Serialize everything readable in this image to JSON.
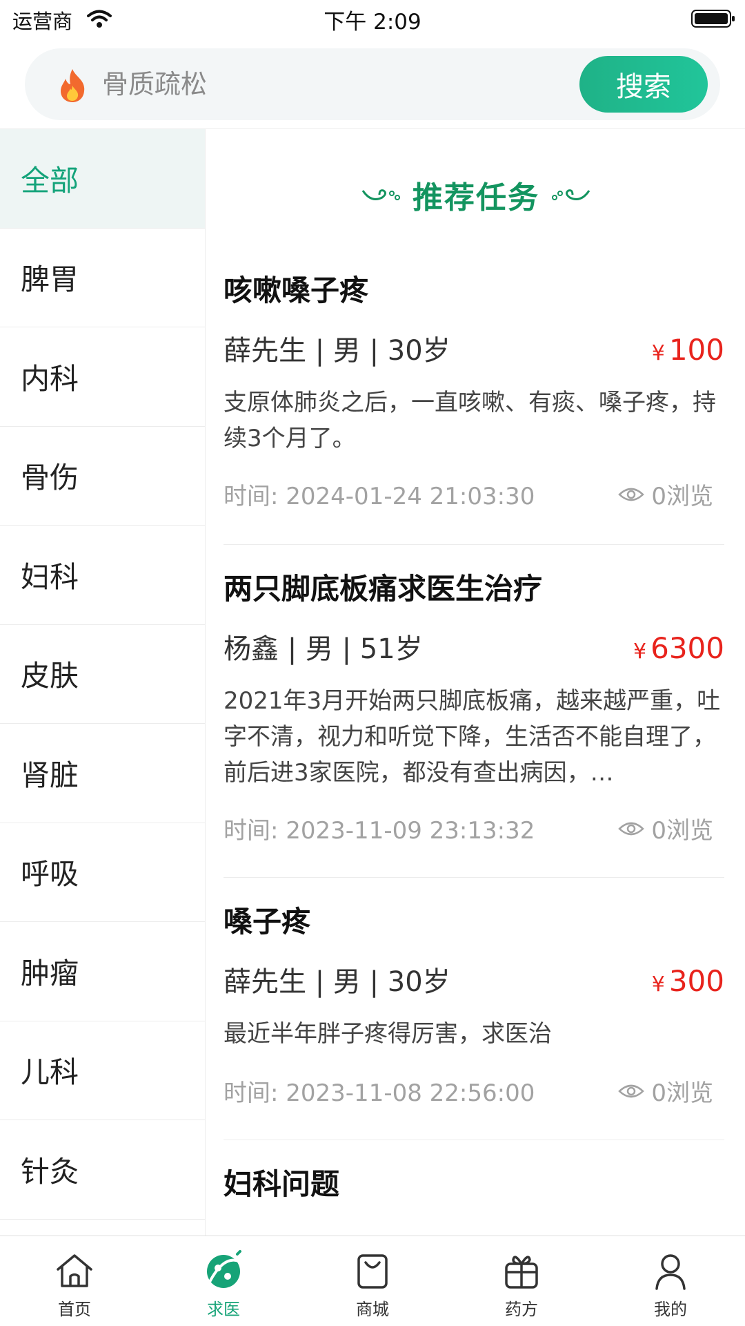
{
  "status_bar": {
    "carrier": "运营商",
    "time": "下午 2:09"
  },
  "search": {
    "placeholder": "骨质疏松",
    "button_label": "搜索"
  },
  "sidebar": {
    "items": [
      {
        "label": "全部",
        "active": true
      },
      {
        "label": "脾胃"
      },
      {
        "label": "内科"
      },
      {
        "label": "骨伤"
      },
      {
        "label": "妇科"
      },
      {
        "label": "皮肤"
      },
      {
        "label": "肾脏"
      },
      {
        "label": "呼吸"
      },
      {
        "label": "肿瘤"
      },
      {
        "label": "儿科"
      },
      {
        "label": "针灸"
      }
    ]
  },
  "main": {
    "section_title": "推荐任务",
    "tasks": [
      {
        "title": "咳嗽嗓子疼",
        "patient": "薛先生 | 男 | 30岁",
        "currency": "¥",
        "price": "100",
        "description": "支原体肺炎之后，一直咳嗽、有痰、嗓子疼，持续3个月了。",
        "time": "时间: 2024-01-24 21:03:30",
        "views": "0浏览"
      },
      {
        "title": "两只脚底板痛求医生治疗",
        "patient": "杨鑫 | 男 | 51岁",
        "currency": "¥",
        "price": "6300",
        "description": "2021年3月开始两只脚底板痛，越来越严重，吐字不清，视力和听觉下降，生活否不能自理了，前后进3家医院，都没有查出病因，…",
        "time": "时间: 2023-11-09 23:13:32",
        "views": "0浏览"
      },
      {
        "title": "嗓子疼",
        "patient": "薛先生 | 男 | 30岁",
        "currency": "¥",
        "price": "300",
        "description": "最近半年胖子疼得厉害，求医治",
        "time": "时间: 2023-11-08 22:56:00",
        "views": "0浏览"
      },
      {
        "title": "妇科问题"
      }
    ]
  },
  "tab_bar": {
    "tabs": [
      {
        "label": "首页",
        "icon": "home-icon"
      },
      {
        "label": "求医",
        "icon": "seek-doctor-icon",
        "active": true
      },
      {
        "label": "商城",
        "icon": "shopping-bag-icon"
      },
      {
        "label": "药方",
        "icon": "prescription-icon"
      },
      {
        "label": "我的",
        "icon": "user-icon"
      }
    ]
  },
  "colors": {
    "accent": "#16a377",
    "price": "#e8231c",
    "active_bg": "#eef5f4"
  }
}
